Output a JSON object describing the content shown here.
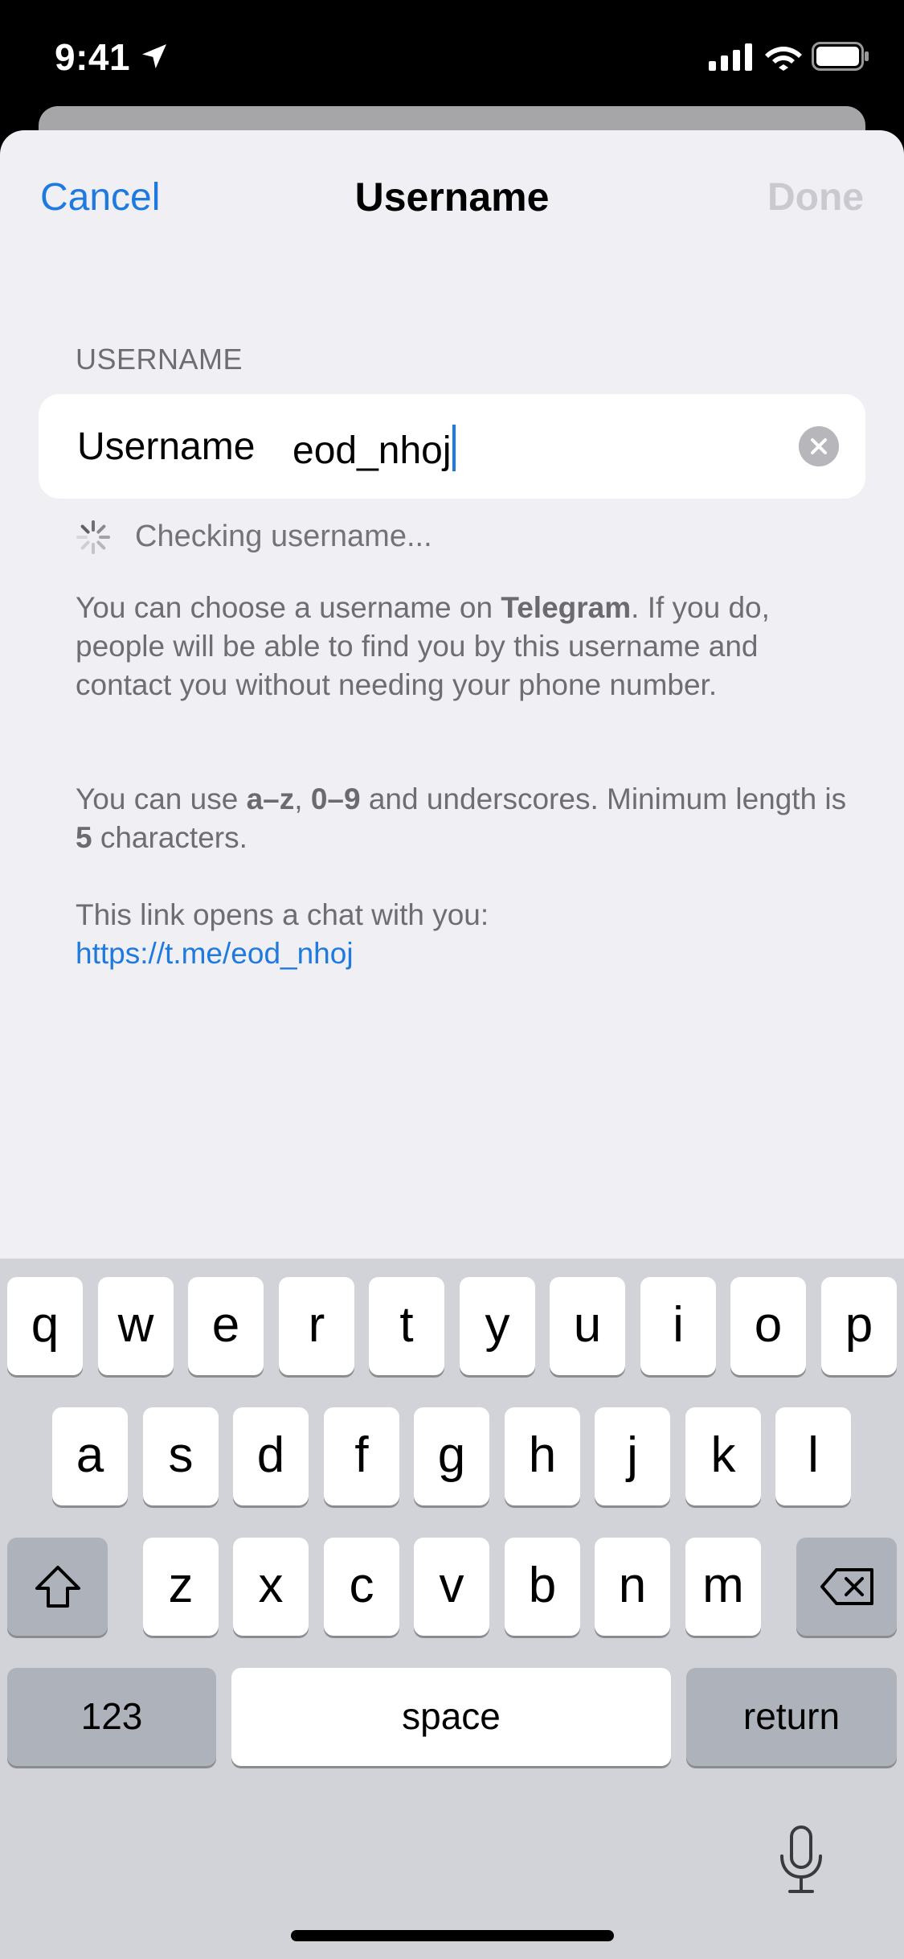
{
  "status_bar": {
    "time": "9:41"
  },
  "nav": {
    "cancel": "Cancel",
    "title": "Username",
    "done": "Done"
  },
  "section_header": "USERNAME",
  "input": {
    "label": "Username",
    "value": "eod_nhoj"
  },
  "checking": "Checking username...",
  "info1": {
    "a": "You can choose a username on ",
    "b": "Telegram",
    "c": ". If you do, people will be able to find you by this username and contact you without needing your phone number."
  },
  "info2": {
    "a": "You can use ",
    "b": "a–z",
    "c": ", ",
    "d": "0–9",
    "e": " and underscores. Minimum length is ",
    "f": "5",
    "g": " characters."
  },
  "info3": {
    "text": "This link opens a chat with you:",
    "link": "https://t.me/eod_nhoj"
  },
  "keyboard": {
    "row1": [
      "q",
      "w",
      "e",
      "r",
      "t",
      "y",
      "u",
      "i",
      "o",
      "p"
    ],
    "row2": [
      "a",
      "s",
      "d",
      "f",
      "g",
      "h",
      "j",
      "k",
      "l"
    ],
    "row3": [
      "z",
      "x",
      "c",
      "v",
      "b",
      "n",
      "m"
    ],
    "numbers": "123",
    "space": "space",
    "return": "return"
  },
  "icons": {
    "location": "location-arrow-icon",
    "signal": "cellular-signal-icon",
    "wifi": "wifi-icon",
    "battery": "battery-icon",
    "clear": "clear-icon",
    "spinner": "spinner-icon",
    "shift": "shift-icon",
    "backspace": "backspace-icon",
    "mic": "microphone-icon"
  },
  "colors": {
    "accent": "#1f7ae0",
    "background": "#efeff4",
    "keyboard": "#d1d3d9"
  }
}
